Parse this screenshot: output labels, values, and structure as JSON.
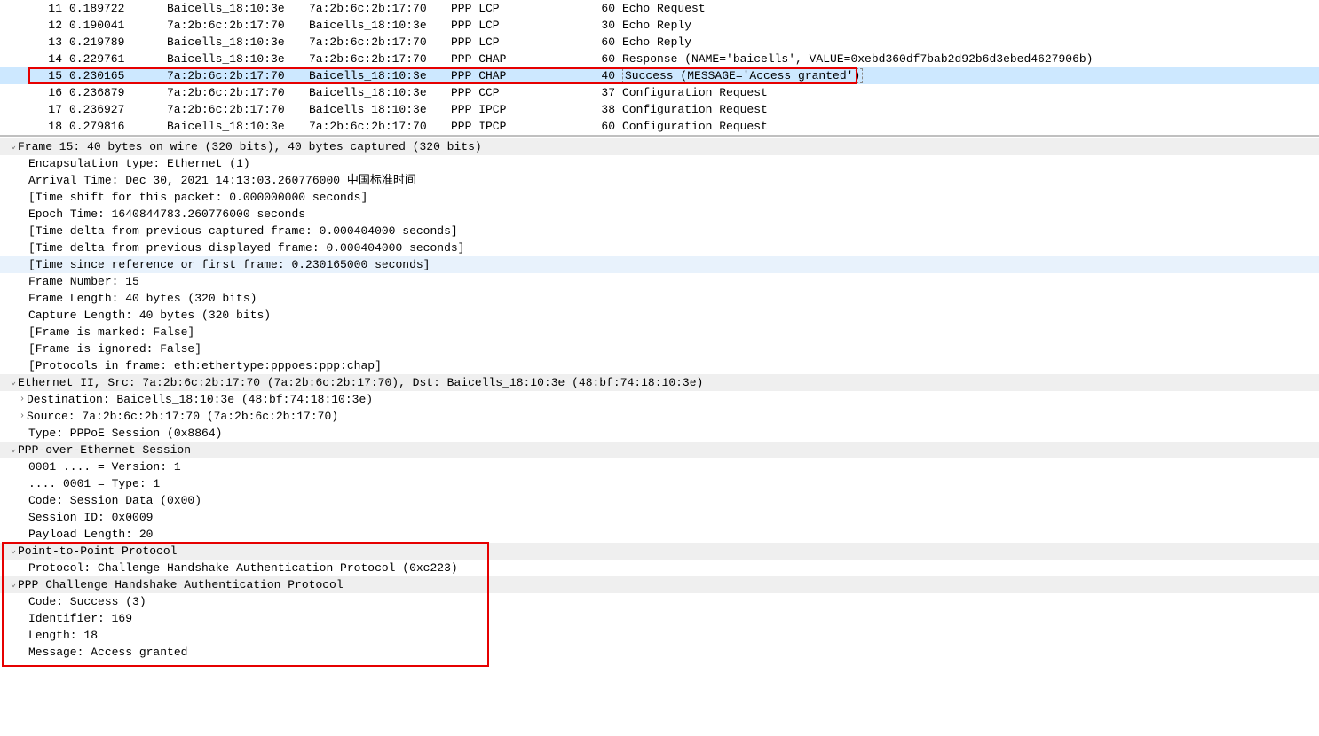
{
  "packets": [
    {
      "no": "11",
      "time": "0.189722",
      "src": "Baicells_18:10:3e",
      "dst": "7a:2b:6c:2b:17:70",
      "proto": "PPP LCP",
      "len": "60",
      "info": "Echo Request"
    },
    {
      "no": "12",
      "time": "0.190041",
      "src": "7a:2b:6c:2b:17:70",
      "dst": "Baicells_18:10:3e",
      "proto": "PPP LCP",
      "len": "30",
      "info": "Echo Reply"
    },
    {
      "no": "13",
      "time": "0.219789",
      "src": "Baicells_18:10:3e",
      "dst": "7a:2b:6c:2b:17:70",
      "proto": "PPP LCP",
      "len": "60",
      "info": "Echo Reply"
    },
    {
      "no": "14",
      "time": "0.229761",
      "src": "Baicells_18:10:3e",
      "dst": "7a:2b:6c:2b:17:70",
      "proto": "PPP CHAP",
      "len": "60",
      "info": "Response (NAME='baicells', VALUE=0xebd360df7bab2d92b6d3ebed4627906b)"
    },
    {
      "no": "15",
      "time": "0.230165",
      "src": "7a:2b:6c:2b:17:70",
      "dst": "Baicells_18:10:3e",
      "proto": "PPP CHAP",
      "len": "40",
      "info": "Success (MESSAGE='Access granted')",
      "selected": true,
      "boxed": true
    },
    {
      "no": "16",
      "time": "0.236879",
      "src": "7a:2b:6c:2b:17:70",
      "dst": "Baicells_18:10:3e",
      "proto": "PPP CCP",
      "len": "37",
      "info": "Configuration Request"
    },
    {
      "no": "17",
      "time": "0.236927",
      "src": "7a:2b:6c:2b:17:70",
      "dst": "Baicells_18:10:3e",
      "proto": "PPP IPCP",
      "len": "38",
      "info": "Configuration Request"
    },
    {
      "no": "18",
      "time": "0.279816",
      "src": "Baicells_18:10:3e",
      "dst": "7a:2b:6c:2b:17:70",
      "proto": "PPP IPCP",
      "len": "60",
      "info": "Configuration Request"
    }
  ],
  "details": {
    "frame_hdr": "Frame 15: 40 bytes on wire (320 bits), 40 bytes captured (320 bits)",
    "encap": "Encapsulation type: Ethernet (1)",
    "arrival": "Arrival Time: Dec 30, 2021 14:13:03.260776000 中国标准时间",
    "tshift": "[Time shift for this packet: 0.000000000 seconds]",
    "epoch": "Epoch Time: 1640844783.260776000 seconds",
    "tdcap": "[Time delta from previous captured frame: 0.000404000 seconds]",
    "tddisp": "[Time delta from previous displayed frame: 0.000404000 seconds]",
    "tref": "[Time since reference or first frame: 0.230165000 seconds]",
    "fno": "Frame Number: 15",
    "flen": "Frame Length: 40 bytes (320 bits)",
    "clen": "Capture Length: 40 bytes (320 bits)",
    "marked": "[Frame is marked: False]",
    "ignored": "[Frame is ignored: False]",
    "protos": "[Protocols in frame: eth:ethertype:pppoes:ppp:chap]",
    "eth_hdr": "Ethernet II, Src: 7a:2b:6c:2b:17:70 (7a:2b:6c:2b:17:70), Dst: Baicells_18:10:3e (48:bf:74:18:10:3e)",
    "eth_dst": "Destination: Baicells_18:10:3e (48:bf:74:18:10:3e)",
    "eth_src": "Source: 7a:2b:6c:2b:17:70 (7a:2b:6c:2b:17:70)",
    "eth_type": "Type: PPPoE Session (0x8864)",
    "pppoe_hdr": "PPP-over-Ethernet Session",
    "pppoe_ver": "0001 .... = Version: 1",
    "pppoe_type": ".... 0001 = Type: 1",
    "pppoe_code": "Code: Session Data (0x00)",
    "pppoe_sid": "Session ID: 0x0009",
    "pppoe_plen": "Payload Length: 20",
    "ppp_hdr": "Point-to-Point Protocol",
    "ppp_proto": "Protocol: Challenge Handshake Authentication Protocol (0xc223)",
    "chap_hdr": "PPP Challenge Handshake Authentication Protocol",
    "chap_code": "Code: Success (3)",
    "chap_id": "Identifier: 169",
    "chap_len": "Length: 18",
    "chap_msg": "Message: Access granted"
  }
}
